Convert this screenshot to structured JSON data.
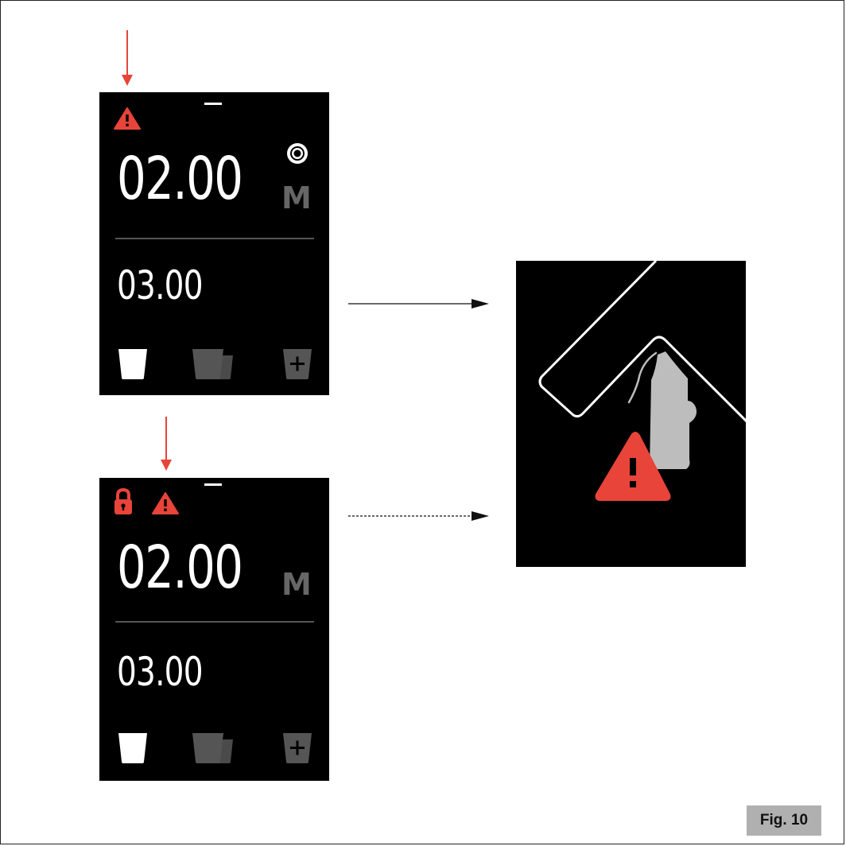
{
  "screens": [
    {
      "main_time": "02.00",
      "secondary_time": "03.00",
      "mode_label": "M",
      "status_icons": [
        "warning-icon"
      ],
      "buttons": [
        "single-cup-icon",
        "double-cup-icon",
        "add-cup-icon"
      ]
    },
    {
      "main_time": "02.00",
      "secondary_time": "03.00",
      "mode_label": "M",
      "status_icons": [
        "lock-icon",
        "warning-icon"
      ],
      "buttons": [
        "single-cup-icon",
        "double-cup-icon",
        "add-cup-icon"
      ]
    }
  ],
  "alert_screen": {
    "icons": [
      "grinder-door-outline",
      "portafilter-holder-icon",
      "warning-icon"
    ]
  },
  "figure_label": "Fig. 10",
  "colors": {
    "warning": "#e8443a",
    "screen_bg": "#000000",
    "inactive": "#555555",
    "divider": "#555555"
  }
}
